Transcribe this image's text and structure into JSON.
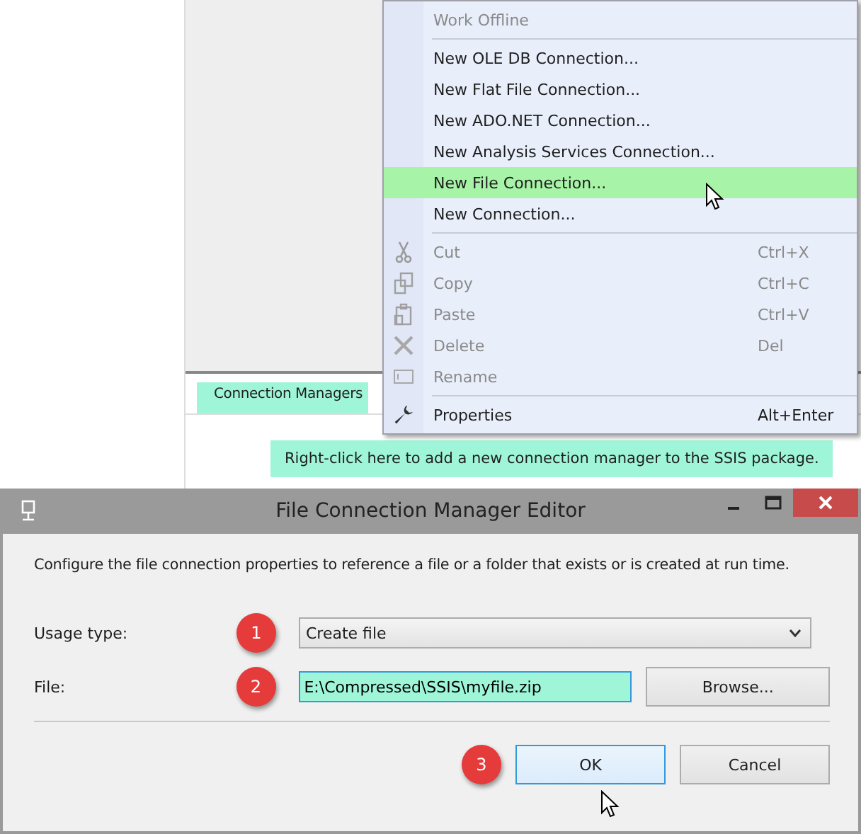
{
  "designer": {
    "tab": {
      "label": "Connection Managers",
      "highlighted": true
    },
    "hint": {
      "text": "Right-click here to add a new connection manager to the SSIS package.",
      "highlighted": true
    }
  },
  "context_menu": {
    "items": [
      {
        "kind": "plain",
        "label": "Work Offline",
        "disabled": true,
        "selected": false
      },
      {
        "kind": "separator"
      },
      {
        "kind": "plain",
        "label": "New OLE DB Connection...",
        "disabled": false,
        "selected": false
      },
      {
        "kind": "plain",
        "label": "New Flat File Connection...",
        "disabled": false,
        "selected": false
      },
      {
        "kind": "plain",
        "label": "New ADO.NET Connection...",
        "disabled": false,
        "selected": false
      },
      {
        "kind": "plain",
        "label": "New Analysis Services Connection...",
        "disabled": false,
        "selected": false
      },
      {
        "kind": "plain",
        "label": "New File Connection...",
        "disabled": false,
        "selected": true
      },
      {
        "kind": "plain",
        "label": "New Connection...",
        "disabled": false,
        "selected": false
      },
      {
        "kind": "separator"
      },
      {
        "kind": "cut",
        "label": "Cut",
        "shortcut": "Ctrl+X",
        "disabled": true,
        "selected": false
      },
      {
        "kind": "copy",
        "label": "Copy",
        "shortcut": "Ctrl+C",
        "disabled": true,
        "selected": false
      },
      {
        "kind": "paste",
        "label": "Paste",
        "shortcut": "Ctrl+V",
        "disabled": true,
        "selected": false
      },
      {
        "kind": "delete",
        "label": "Delete",
        "shortcut": "Del",
        "disabled": true,
        "selected": false
      },
      {
        "kind": "rename",
        "label": "Rename",
        "disabled": true,
        "selected": false
      },
      {
        "kind": "separator"
      },
      {
        "kind": "properties",
        "label": "Properties",
        "shortcut": "Alt+Enter",
        "disabled": false,
        "selected": false
      }
    ]
  },
  "dialog": {
    "title": "File Connection Manager Editor",
    "description": "Configure the file connection properties to reference a file or a folder that exists or is created at run time.",
    "fields": [
      {
        "kind": "dropdown",
        "label": "Usage type:",
        "value": "Create file",
        "step": "1",
        "highlighted": false
      },
      {
        "kind": "text",
        "label": "File:",
        "value": "E:\\Compressed\\SSIS\\myfile.zip",
        "step": "2",
        "highlighted": true,
        "button": "Browse..."
      }
    ],
    "buttons": [
      {
        "label": "OK",
        "default": true,
        "step": "3"
      },
      {
        "label": "Cancel",
        "default": false
      }
    ]
  }
}
